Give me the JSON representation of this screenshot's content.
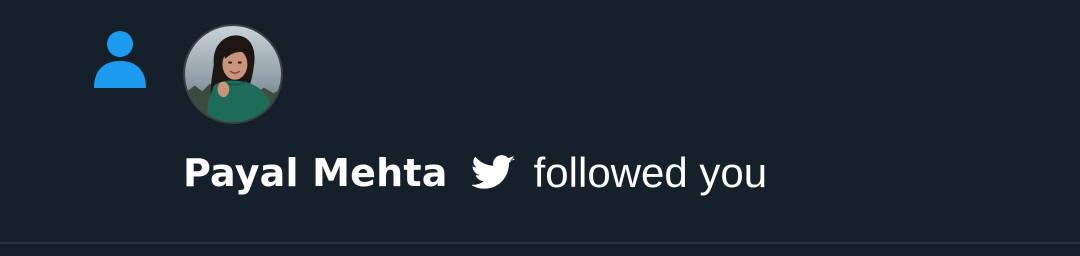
{
  "notification": {
    "type_icon": "person-icon",
    "avatar": "user-avatar-photo",
    "user_name": "Payal Mehta",
    "platform_icon": "twitter-bird-icon",
    "action_text": "followed you"
  },
  "colors": {
    "background": "#15202b",
    "accent": "#1d9bf0",
    "text": "#ffffff",
    "divider": "#253341"
  }
}
